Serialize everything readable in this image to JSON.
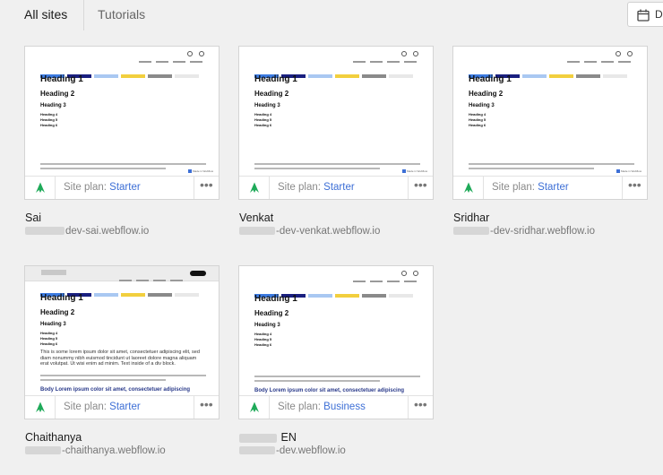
{
  "tabs": {
    "all_sites": "All sites",
    "tutorials": "Tutorials"
  },
  "top_button": {
    "label": "D"
  },
  "plan_label": "Site plan:",
  "more": "•••",
  "thumbnail": {
    "h1": "Heading 1",
    "h2": "Heading 2",
    "h3": "Heading 3",
    "h4": "Heading 4",
    "h5": "Heading 5",
    "h6": "Heading 6",
    "badge": "Made in Webflow",
    "body_large": "This is some lorem ipsum dolor sit amet, consectetuer adipiscing elit, sed diam nonummy nibh euismod tincidunt ut laoreet dolore magna aliquam erat volutpat. Ut wisi enim ad minim. Text inside of a div block.",
    "body_blue": "Body Lorem ipsum color sit amet, consectetuer adipiscing",
    "bar_colors": [
      "#3b7ae0",
      "#1a2080",
      "#a9c8f2",
      "#f2cf3e",
      "#8a8a8a",
      "#e8e8e8"
    ]
  },
  "sites": [
    {
      "name": "Sai",
      "url": "dev-sai.webflow.io",
      "plan": "Starter"
    },
    {
      "name": "Venkat",
      "url": "-dev-venkat.webflow.io",
      "plan": "Starter"
    },
    {
      "name": "Sridhar",
      "url": "-dev-sridhar.webflow.io",
      "plan": "Starter"
    },
    {
      "name": "Chaithanya",
      "url": "-chaithanya.webflow.io",
      "plan": "Starter"
    },
    {
      "name": "EN",
      "url": "-dev.webflow.io",
      "plan": "Business"
    }
  ],
  "colors": {
    "accent_green": "#1faa59",
    "link_blue": "#3d6fd6"
  }
}
